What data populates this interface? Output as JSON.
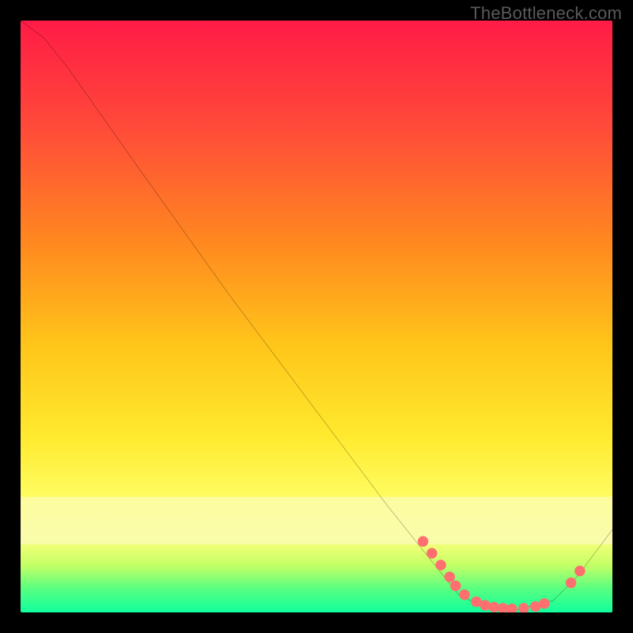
{
  "watermark": "TheBottleneck.com",
  "chart_data": {
    "type": "line",
    "title": "",
    "xlabel": "",
    "ylabel": "",
    "xlim": [
      0,
      100
    ],
    "ylim": [
      0,
      100
    ],
    "grid": false,
    "legend": false,
    "axes_visible": false,
    "series": [
      {
        "name": "curve",
        "points": [
          {
            "x": 0,
            "y": 100
          },
          {
            "x": 4,
            "y": 97
          },
          {
            "x": 8,
            "y": 92
          },
          {
            "x": 20,
            "y": 75
          },
          {
            "x": 35,
            "y": 54
          },
          {
            "x": 50,
            "y": 34
          },
          {
            "x": 62,
            "y": 18
          },
          {
            "x": 70,
            "y": 8
          },
          {
            "x": 74,
            "y": 3
          },
          {
            "x": 78,
            "y": 1
          },
          {
            "x": 84,
            "y": 0.5
          },
          {
            "x": 90,
            "y": 2
          },
          {
            "x": 94,
            "y": 6
          },
          {
            "x": 100,
            "y": 14
          }
        ]
      }
    ],
    "highlight_dots": [
      {
        "x": 68,
        "y": 12
      },
      {
        "x": 69.5,
        "y": 10
      },
      {
        "x": 71,
        "y": 8
      },
      {
        "x": 72.5,
        "y": 6
      },
      {
        "x": 73.5,
        "y": 4.5
      },
      {
        "x": 75,
        "y": 3
      },
      {
        "x": 77,
        "y": 1.8
      },
      {
        "x": 78.5,
        "y": 1.2
      },
      {
        "x": 80,
        "y": 0.9
      },
      {
        "x": 81.5,
        "y": 0.7
      },
      {
        "x": 83,
        "y": 0.6
      },
      {
        "x": 85,
        "y": 0.7
      },
      {
        "x": 87,
        "y": 1.0
      },
      {
        "x": 88.5,
        "y": 1.5
      },
      {
        "x": 93,
        "y": 5
      },
      {
        "x": 94.5,
        "y": 7
      }
    ],
    "gradient_bands": [
      {
        "pct": 0,
        "color": "#ff1b46"
      },
      {
        "pct": 18,
        "color": "#ff4a39"
      },
      {
        "pct": 38,
        "color": "#ff8a1f"
      },
      {
        "pct": 55,
        "color": "#ffc61a"
      },
      {
        "pct": 70,
        "color": "#ffe92e"
      },
      {
        "pct": 82,
        "color": "#ffff68"
      },
      {
        "pct": 92,
        "color": "#c4ff66"
      },
      {
        "pct": 100,
        "color": "#10ff9d"
      }
    ],
    "dot_color": "#ff6f6f",
    "line_color": "#000000"
  }
}
